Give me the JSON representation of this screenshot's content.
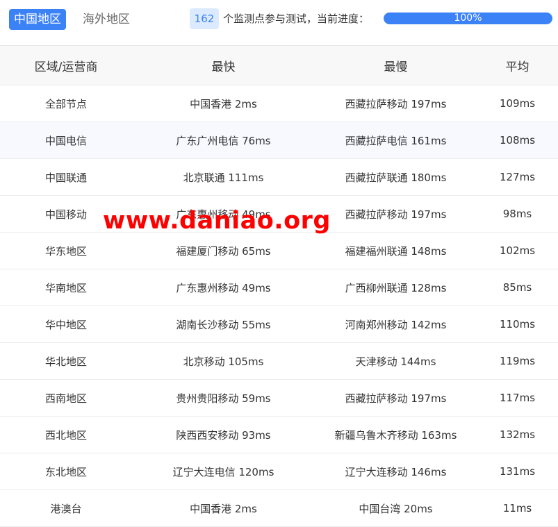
{
  "tabs": {
    "active": "中国地区",
    "inactive": "海外地区"
  },
  "status": {
    "count": "162",
    "text": "个监测点参与测试，当前进度：",
    "progress_label": "100%",
    "progress_fraction": 1.0
  },
  "table": {
    "headers": [
      "区域/运营商",
      "最快",
      "最慢",
      "平均"
    ],
    "rows": [
      [
        "全部节点",
        "中国香港 2ms",
        "西藏拉萨移动 197ms",
        "109ms"
      ],
      [
        "中国电信",
        "广东广州电信 76ms",
        "西藏拉萨电信 161ms",
        "108ms"
      ],
      [
        "中国联通",
        "北京联通 111ms",
        "西藏拉萨联通 180ms",
        "127ms"
      ],
      [
        "中国移动",
        "广东惠州移动 49ms",
        "西藏拉萨移动 197ms",
        "98ms"
      ],
      [
        "华东地区",
        "福建厦门移动 65ms",
        "福建福州联通 148ms",
        "102ms"
      ],
      [
        "华南地区",
        "广东惠州移动 49ms",
        "广西柳州联通 128ms",
        "85ms"
      ],
      [
        "华中地区",
        "湖南长沙移动 55ms",
        "河南郑州移动 142ms",
        "110ms"
      ],
      [
        "华北地区",
        "北京移动 105ms",
        "天津移动 144ms",
        "119ms"
      ],
      [
        "西南地区",
        "贵州贵阳移动 59ms",
        "西藏拉萨移动 197ms",
        "117ms"
      ],
      [
        "西北地区",
        "陕西西安移动 93ms",
        "新疆乌鲁木齐移动 163ms",
        "132ms"
      ],
      [
        "东北地区",
        "辽宁大连电信 120ms",
        "辽宁大连移动 146ms",
        "131ms"
      ],
      [
        "港澳台",
        "中国香港 2ms",
        "中国台湾 20ms",
        "11ms"
      ]
    ]
  },
  "watermark": "www.daniao.org",
  "colors": {
    "accent": "#3b82f6",
    "watermark": "#ff0000"
  }
}
